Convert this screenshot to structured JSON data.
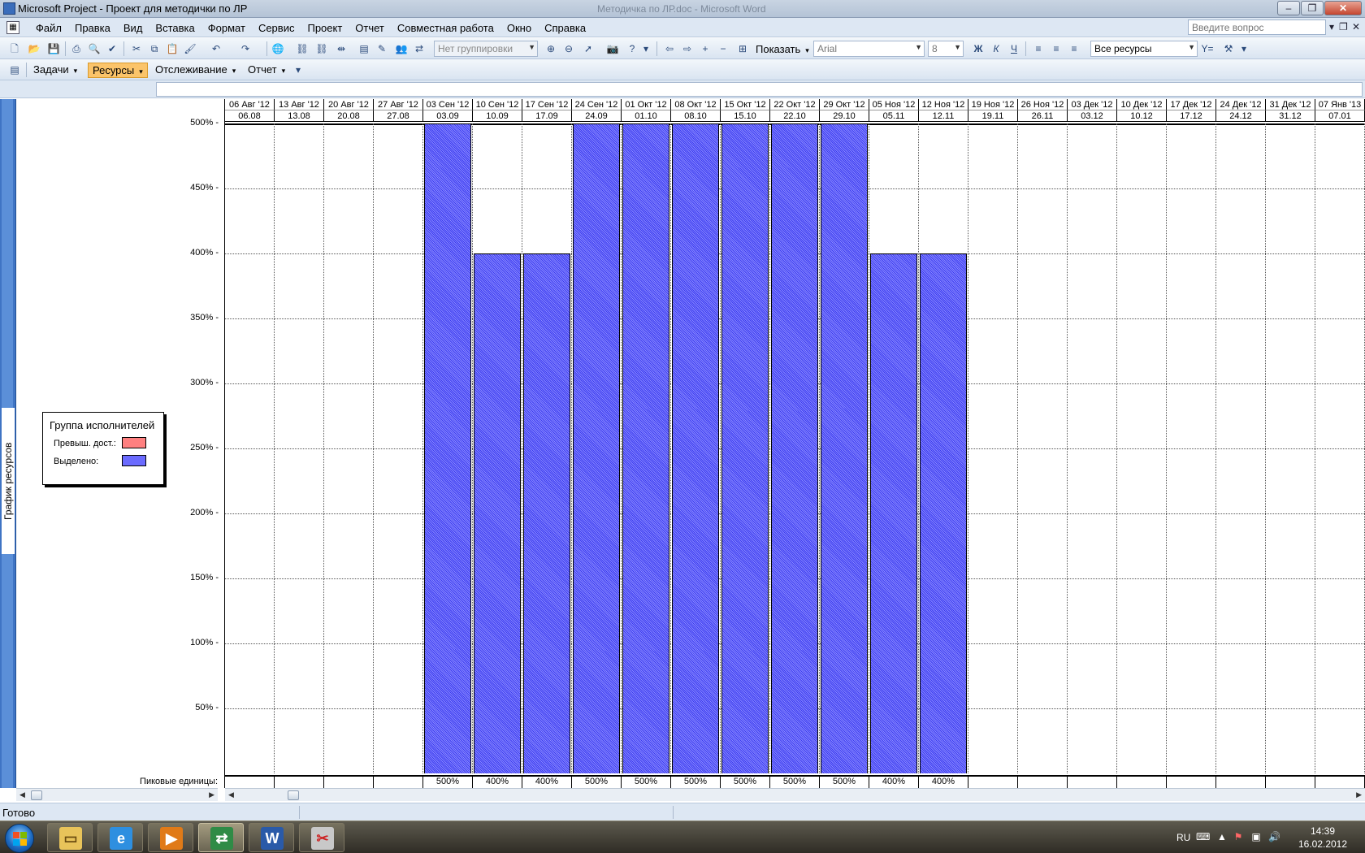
{
  "window": {
    "title": "Microsoft Project - Проект для методички по ЛР",
    "ghost_title": "Методичка по ЛР.doc - Microsoft Word"
  },
  "menu": {
    "items": [
      "Файл",
      "Правка",
      "Вид",
      "Вставка",
      "Формат",
      "Сервис",
      "Проект",
      "Отчет",
      "Совместная работа",
      "Окно",
      "Справка"
    ],
    "help_placeholder": "Введите вопрос"
  },
  "toolbar": {
    "grouping_value": "Нет группировки",
    "show_label": "Показать",
    "font_value": "Arial",
    "font_size_value": "8",
    "bold_label": "Ж",
    "italic_label": "К",
    "underline_label": "Ч",
    "filter_value": "Все ресурсы"
  },
  "guide_toolbar": {
    "items": [
      "Задачи",
      "Ресурсы",
      "Отслеживание",
      "Отчет"
    ],
    "active": "Ресурсы"
  },
  "view": {
    "side_label": "График ресурсов",
    "peak_units_label": "Пиковые единицы:"
  },
  "legend": {
    "title": "Группа исполнителей",
    "overallocated_label": "Превыш. дост.:",
    "allocated_label": "Выделено:",
    "overallocated_color": "#ff8080",
    "allocated_color": "#6b6bff"
  },
  "chart_data": {
    "type": "bar",
    "ylim": [
      0,
      500
    ],
    "yticks": [
      "500% -",
      "450% -",
      "400% -",
      "350% -",
      "300% -",
      "250% -",
      "200% -",
      "150% -",
      "100% -",
      "50% -"
    ],
    "columns": [
      {
        "week": "06 Авг '12",
        "date": "06.08",
        "value": 0,
        "peak": ""
      },
      {
        "week": "13 Авг '12",
        "date": "13.08",
        "value": 0,
        "peak": ""
      },
      {
        "week": "20 Авг '12",
        "date": "20.08",
        "value": 0,
        "peak": ""
      },
      {
        "week": "27 Авг '12",
        "date": "27.08",
        "value": 0,
        "peak": ""
      },
      {
        "week": "03 Сен '12",
        "date": "03.09",
        "value": 500,
        "peak": "500%"
      },
      {
        "week": "10 Сен '12",
        "date": "10.09",
        "value": 400,
        "peak": "400%"
      },
      {
        "week": "17 Сен '12",
        "date": "17.09",
        "value": 400,
        "peak": "400%"
      },
      {
        "week": "24 Сен '12",
        "date": "24.09",
        "value": 500,
        "peak": "500%"
      },
      {
        "week": "01 Окт '12",
        "date": "01.10",
        "value": 500,
        "peak": "500%"
      },
      {
        "week": "08 Окт '12",
        "date": "08.10",
        "value": 500,
        "peak": "500%"
      },
      {
        "week": "15 Окт '12",
        "date": "15.10",
        "value": 500,
        "peak": "500%"
      },
      {
        "week": "22 Окт '12",
        "date": "22.10",
        "value": 500,
        "peak": "500%"
      },
      {
        "week": "29 Окт '12",
        "date": "29.10",
        "value": 500,
        "peak": "500%"
      },
      {
        "week": "05 Ноя '12",
        "date": "05.11",
        "value": 400,
        "peak": "400%"
      },
      {
        "week": "12 Ноя '12",
        "date": "12.11",
        "value": 400,
        "peak": "400%"
      },
      {
        "week": "19 Ноя '12",
        "date": "19.11",
        "value": 0,
        "peak": ""
      },
      {
        "week": "26 Ноя '12",
        "date": "26.11",
        "value": 0,
        "peak": ""
      },
      {
        "week": "03 Дек '12",
        "date": "03.12",
        "value": 0,
        "peak": ""
      },
      {
        "week": "10 Дек '12",
        "date": "10.12",
        "value": 0,
        "peak": ""
      },
      {
        "week": "17 Дек '12",
        "date": "17.12",
        "value": 0,
        "peak": ""
      },
      {
        "week": "24 Дек '12",
        "date": "24.12",
        "value": 0,
        "peak": ""
      },
      {
        "week": "31 Дек '12",
        "date": "31.12",
        "value": 0,
        "peak": ""
      },
      {
        "week": "07 Янв '13",
        "date": "07.01",
        "value": 0,
        "peak": ""
      }
    ]
  },
  "status": {
    "text": "Готово"
  },
  "taskbar": {
    "language": "RU",
    "time": "14:39",
    "date": "16.02.2012"
  }
}
